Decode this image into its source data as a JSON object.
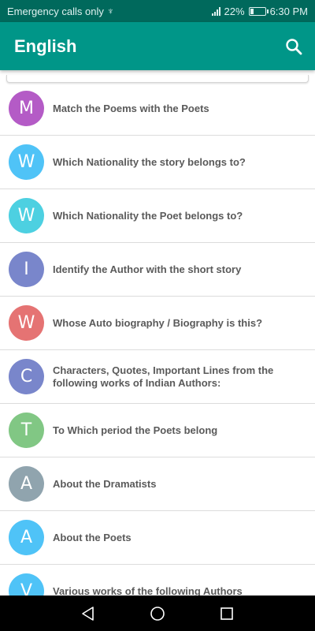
{
  "status_bar": {
    "carrier": "Emergency calls only",
    "usb_icon": "usb-icon",
    "signal_icon": "signal-icon",
    "battery_percent": "22%",
    "battery_level": 0.22,
    "time": "6:30 PM"
  },
  "app_bar": {
    "title": "English",
    "search_icon": "search-icon"
  },
  "colors": {
    "status_bar": "#00695c",
    "app_bar": "#009688",
    "item_text": "#5a5a5a"
  },
  "items": [
    {
      "letter": "M",
      "label": "Match the Poems with the Poets",
      "color": "#b45bc6"
    },
    {
      "letter": "W",
      "label": "Which Nationality the story belongs to?",
      "color": "#4fc3f7"
    },
    {
      "letter": "W",
      "label": "Which Nationality the Poet belongs to?",
      "color": "#4dd0e1"
    },
    {
      "letter": "I",
      "label": "Identify the Author with the short story",
      "color": "#7986cb"
    },
    {
      "letter": "W",
      "label": "Whose Auto biography / Biography is this?",
      "color": "#e57373"
    },
    {
      "letter": "C",
      "label": "Characters, Quotes, Important Lines from the following works of Indian Authors:",
      "color": "#7986cb"
    },
    {
      "letter": "T",
      "label": "To Which period the Poets belong",
      "color": "#81c784"
    },
    {
      "letter": "A",
      "label": "About the Dramatists",
      "color": "#90a4ae"
    },
    {
      "letter": "A",
      "label": "About the Poets",
      "color": "#4fc3f7"
    },
    {
      "letter": "V",
      "label": "Various works of the following Authors",
      "color": "#4fc3f7"
    }
  ],
  "nav_bar": {
    "back_icon": "back-triangle-icon",
    "home_icon": "home-circle-icon",
    "recents_icon": "recents-square-icon"
  }
}
